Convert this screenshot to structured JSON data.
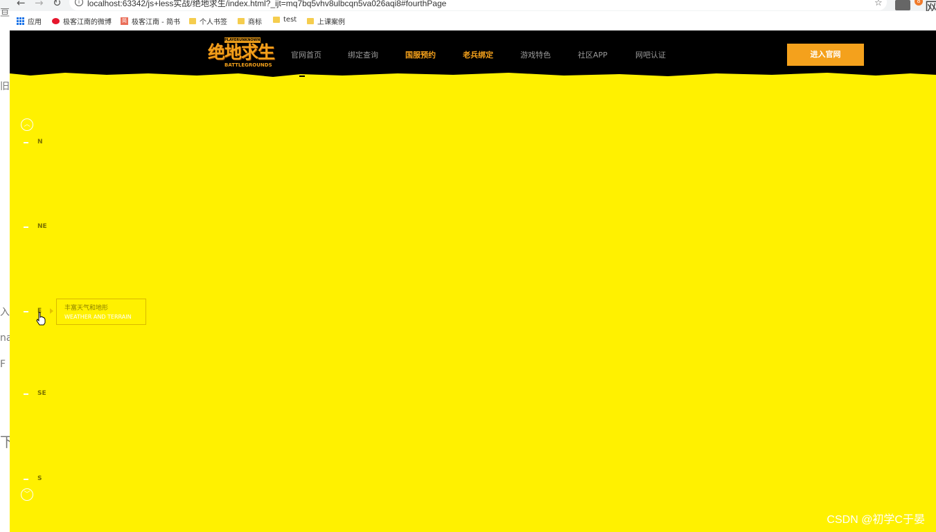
{
  "browser": {
    "url": "localhost:63342/js+less实战/绝地求生/index.html?_ijt=mq7bq5vhv8ulbcqn5va026aqi8#fourthPage",
    "bookmarks": [
      {
        "label": "应用"
      },
      {
        "label": "极客江南的微博"
      },
      {
        "label": "极客江南 - 简书"
      },
      {
        "label": "个人书签"
      },
      {
        "label": "商标"
      },
      {
        "label": "test"
      },
      {
        "label": "上课案例"
      }
    ],
    "extension_char": "网"
  },
  "left_edge": [
    "旧",
    "亘",
    "入",
    "na",
    "F",
    "下"
  ],
  "site": {
    "logo": {
      "top_text": "PLAYERUNKNOWN'S",
      "main_text": "绝地求生",
      "sub_text": "BATTLEGROUNDS"
    },
    "nav": [
      {
        "label": "官网首页"
      },
      {
        "label": "绑定查询"
      },
      {
        "label": "国服预约"
      },
      {
        "label": "老兵绑定"
      },
      {
        "label": "游戏特色"
      },
      {
        "label": "社区APP"
      },
      {
        "label": "网吧认证"
      }
    ],
    "enter_button": "进入官网",
    "side_nav": {
      "up_icon": "chevron-up-circle-icon",
      "down_icon": "chevron-down-circle-icon",
      "items": [
        {
          "label": "N"
        },
        {
          "label": "NE"
        },
        {
          "label": "E"
        },
        {
          "label": "SE"
        },
        {
          "label": "S"
        }
      ],
      "tooltip": {
        "cn": "丰富天气和地形",
        "en": "WEATHER AND TERRAIN"
      }
    },
    "colors": {
      "background": "#fff100",
      "header": "#000000",
      "accent": "#f4a11c"
    }
  },
  "watermark": "CSDN @初学C于晏"
}
